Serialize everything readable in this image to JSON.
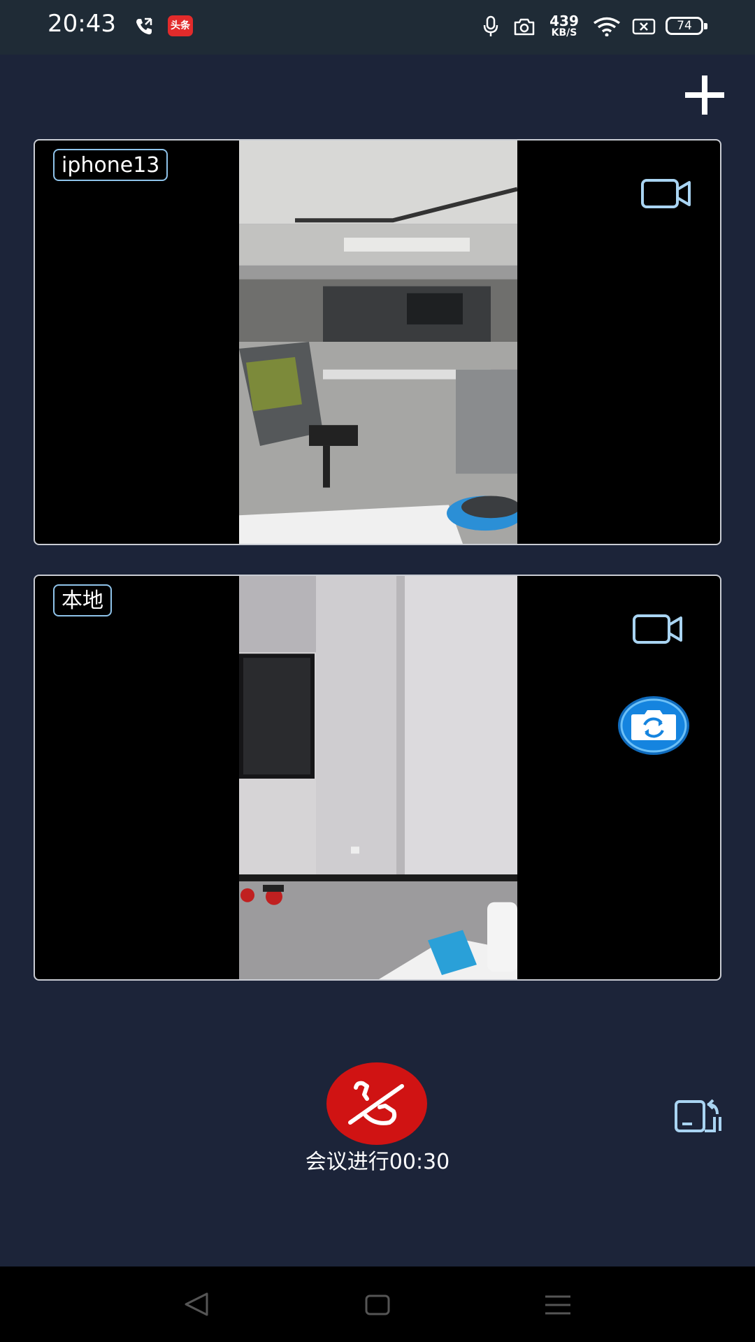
{
  "status_bar": {
    "time": "20:43",
    "news_badge": "头条",
    "net_speed": "439",
    "net_speed_unit": "KB/S",
    "battery": "74",
    "icons": [
      "call-icon",
      "news-app-icon",
      "mic-icon",
      "camera-icon",
      "wifi-icon",
      "no-sim-icon",
      "battery-icon"
    ]
  },
  "toolbar": {
    "add_icon": "plus-icon"
  },
  "participants": [
    {
      "name": "iphone13",
      "video_icon": "video-camera-icon"
    },
    {
      "name": "本地",
      "video_icon": "video-camera-icon",
      "switch_icon": "switch-camera-icon"
    }
  ],
  "controls": {
    "hangup_icon": "hangup-phone-icon",
    "status_text": "会议进行00:30",
    "rotate_icon": "rotate-screen-icon"
  },
  "nav": {
    "icons": [
      "back-icon",
      "home-icon",
      "menu-icon"
    ]
  },
  "colors": {
    "background": "#1c2439",
    "status_bar": "#1f2b36",
    "card_border": "#c9ccd3",
    "accent_blue": "#8fc3ea",
    "hangup_red": "#d01313",
    "switch_blue": "#1584df"
  }
}
